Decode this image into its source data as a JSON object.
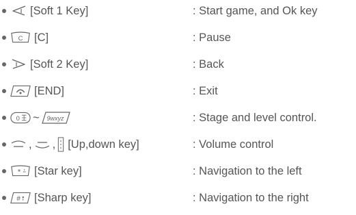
{
  "rows": [
    {
      "icon": "soft-1-key-icon",
      "label": "[Soft 1 Key]",
      "desc": ": Start game, and Ok key"
    },
    {
      "icon": "c-key-icon",
      "icon_text": "C",
      "label": "[C]",
      "desc": ": Pause"
    },
    {
      "icon": "soft-2-key-icon",
      "label": "[Soft 2 Key]",
      "desc": ": Back"
    },
    {
      "icon": "end-key-icon",
      "label": "[END]",
      "desc": ": Exit"
    },
    {
      "icon": "zero-to-nine-keys-icon",
      "icon_text_start": "0",
      "icon_text_end": "9wxyz",
      "separator": "~",
      "label": "",
      "desc": ": Stage and level control."
    },
    {
      "icon": "up-down-keys-icon",
      "separator": ",",
      "label": "[Up,down key]",
      "desc": ": Volume control"
    },
    {
      "icon": "star-key-icon",
      "icon_text": "*",
      "label": "[Star key]",
      "desc": ": Navigation to the left"
    },
    {
      "icon": "sharp-key-icon",
      "icon_text": "#",
      "label": "[Sharp key]",
      "desc": ": Navigation to the right"
    }
  ]
}
